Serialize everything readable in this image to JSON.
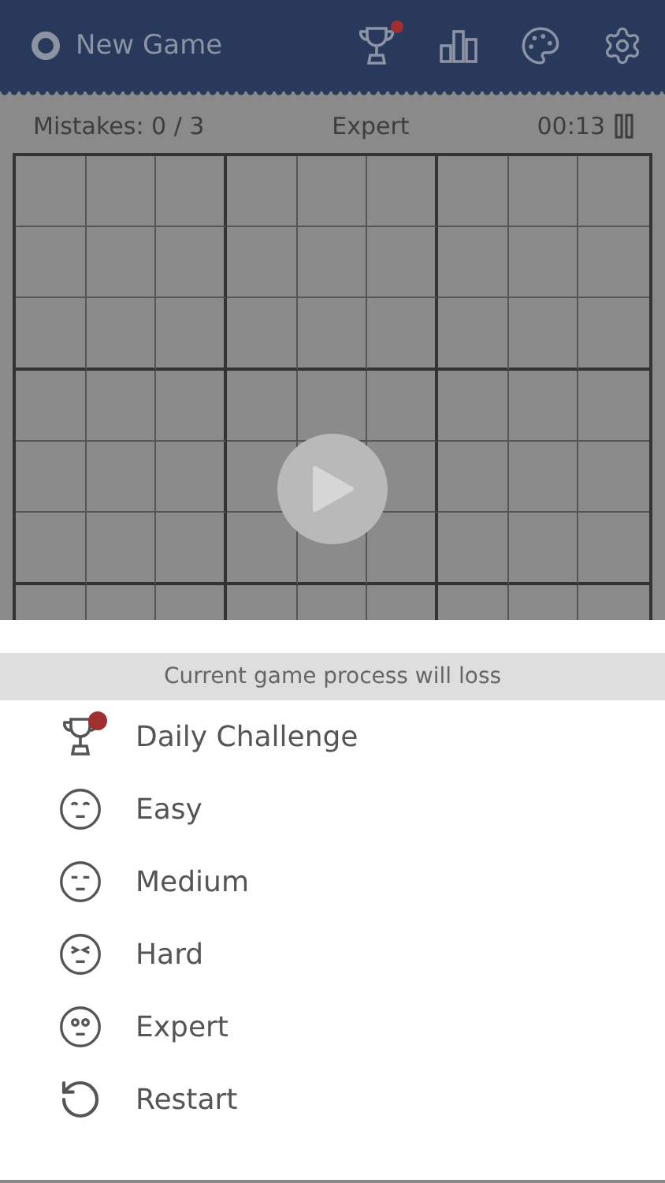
{
  "header": {
    "title": "New Game",
    "icons": [
      {
        "kind": "trophy",
        "badge": true
      },
      {
        "kind": "stats",
        "badge": false
      },
      {
        "kind": "palette",
        "badge": false
      },
      {
        "kind": "settings",
        "badge": false
      }
    ]
  },
  "status": {
    "mistakes": "Mistakes: 0 / 3",
    "difficulty": "Expert",
    "timer": "00:13"
  },
  "sheet": {
    "notice": "Current game process will loss",
    "items": [
      {
        "kind": "trophy",
        "label": "Daily Challenge",
        "badge": true
      },
      {
        "kind": "easy",
        "label": "Easy",
        "badge": false
      },
      {
        "kind": "medium",
        "label": "Medium",
        "badge": false
      },
      {
        "kind": "hard",
        "label": "Hard",
        "badge": false
      },
      {
        "kind": "expert",
        "label": "Expert",
        "badge": false
      },
      {
        "kind": "restart",
        "label": "Restart",
        "badge": false
      }
    ]
  }
}
